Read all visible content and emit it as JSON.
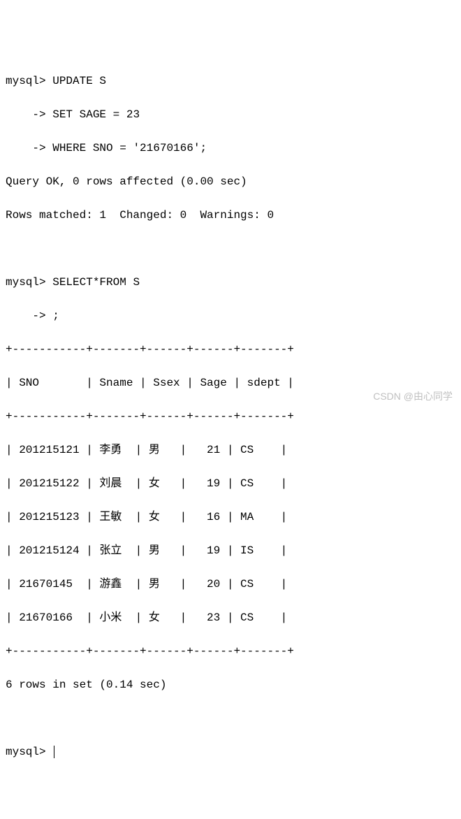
{
  "prompt_main": "mysql> ",
  "prompt_cont": "    -> ",
  "update_lines": [
    "UPDATE S",
    "SET SAGE = 23",
    "WHERE SNO = '21670166';"
  ],
  "update_result1": "Query OK, 0 rows affected (0.00 sec)",
  "update_result2": "Rows matched: 1  Changed: 0  Warnings: 0",
  "select_lines": [
    "SELECT*FROM S",
    ";"
  ],
  "table": {
    "border": "+-----------+-------+------+------+-------+",
    "header": "| SNO       | Sname | Ssex | Sage | sdept |",
    "rows": [
      "| 201215121 | 李勇  | 男   |   21 | CS    |",
      "| 201215122 | 刘晨  | 女   |   19 | CS    |",
      "| 201215123 | 王敏  | 女   |   16 | MA    |",
      "| 201215124 | 张立  | 男   |   19 | IS    |",
      "| 21670145  | 游鑫  | 男   |   20 | CS    |",
      "| 21670166  | 小米  | 女   |   23 | CS    |"
    ]
  },
  "rows_summary": "6 rows in set (0.14 sec)",
  "watermark": "CSDN @由心同学",
  "chart_data": {
    "type": "table",
    "columns": [
      "SNO",
      "Sname",
      "Ssex",
      "Sage",
      "sdept"
    ],
    "data": [
      [
        "201215121",
        "李勇",
        "男",
        21,
        "CS"
      ],
      [
        "201215122",
        "刘晨",
        "女",
        19,
        "CS"
      ],
      [
        "201215123",
        "王敏",
        "女",
        16,
        "MA"
      ],
      [
        "201215124",
        "张立",
        "男",
        19,
        "IS"
      ],
      [
        "21670145",
        "游鑫",
        "男",
        20,
        "CS"
      ],
      [
        "21670166",
        "小米",
        "女",
        23,
        "CS"
      ]
    ]
  }
}
